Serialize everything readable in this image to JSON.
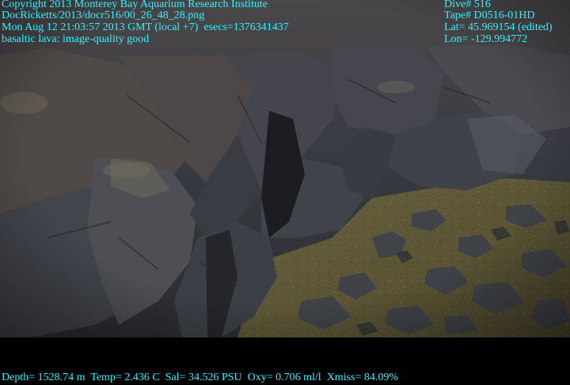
{
  "header_left": [
    "Copyright 2013 Monterey Bay Aquarium Research Institute",
    "DocRicketts/2013/docr516/00_26_48_28.png",
    "Mon Aug 12 21:03:57 2013 GMT (local +7)  esecs=1376341437",
    "basaltic lava: image-quality good"
  ],
  "header_right": [
    "Dive# 516",
    "Tape# D0516-01HD",
    "Lat= 45.969154 (edited)",
    "Lon= -129.994772"
  ],
  "footer": {
    "telemetry": "Depth= 1528.74 m  Temp= 2.436 C  Sal= 34.526 PSU  Oxy= 0.706 ml/l  Xmiss= 84.09%"
  },
  "colors": {
    "overlay_text": "#33f0ff",
    "background": "#000000",
    "sediment": "#5e5634",
    "basalt": "#3b3f48"
  }
}
